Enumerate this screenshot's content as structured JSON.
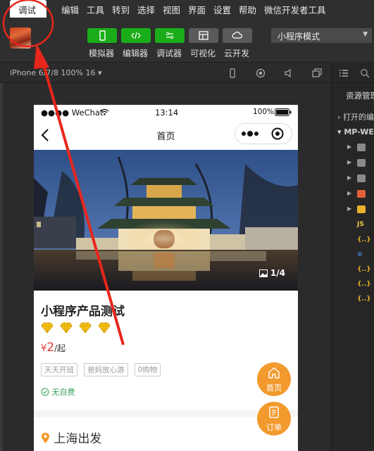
{
  "menubar": {
    "active": "调试",
    "items": [
      "编辑",
      "工具",
      "转到",
      "选择",
      "视图",
      "界面",
      "设置",
      "帮助",
      "微信开发者工具"
    ]
  },
  "toolbar": {
    "buttons": [
      {
        "label": "模拟器",
        "icon": "phone-icon"
      },
      {
        "label": "编辑器",
        "icon": "code-icon"
      },
      {
        "label": "调试器",
        "icon": "debug-icon"
      },
      {
        "label": "可视化",
        "icon": "layout-icon"
      },
      {
        "label": "云开发",
        "icon": "cloud-icon"
      }
    ],
    "mode": "小程序模式"
  },
  "simulator": {
    "device": "iPhone 6/7/8 100% 16 ▾"
  },
  "right_panel": {
    "title": "资源管理",
    "open_section": "打开的编",
    "project_section": "MP-WE"
  },
  "phone": {
    "status": {
      "carrier": "●●●● WeChat",
      "time": "13:14",
      "battery": "100%"
    },
    "nav": {
      "title": "首页",
      "back_label": "‹"
    },
    "gallery": {
      "current": 1,
      "total": 4,
      "counter": "1/4"
    },
    "product": {
      "title": "小程序产品测试",
      "rating_diamonds": 4,
      "price_symbol": "¥",
      "price": "2",
      "price_unit": "/起",
      "tags": [
        "天天开班",
        "爸妈放心游",
        "0购物"
      ],
      "no_fee": "无自费",
      "departure": "上海出发"
    },
    "fabs": {
      "home": "首页",
      "orders": "订单"
    }
  },
  "colors": {
    "accent_green": "#1aad19",
    "fab_orange": "#f39a2e",
    "price_red": "#e4393c",
    "annotation_red": "#e8261c"
  }
}
